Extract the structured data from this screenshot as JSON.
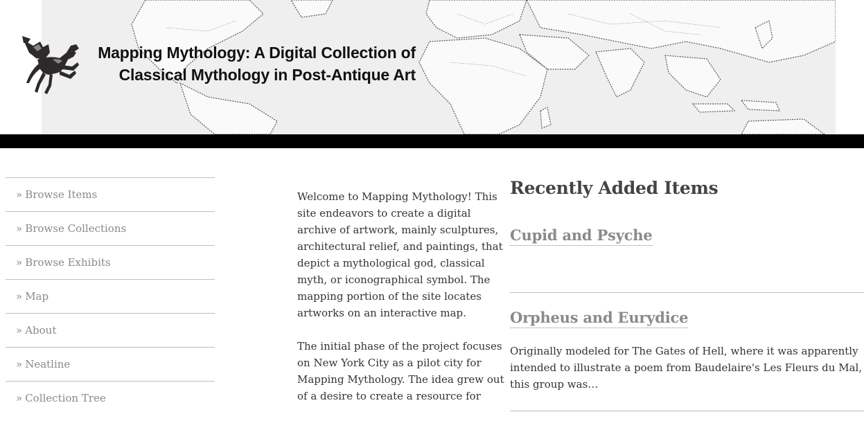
{
  "header": {
    "title_line1": "Mapping Mythology: A Digital Collection of",
    "title_line2": "Classical Mythology in Post-Antique Art",
    "logo_icon": "pegasus-statue-icon",
    "background_icon": "world-map-background"
  },
  "nav": {
    "items": [
      {
        "label": "Browse Items"
      },
      {
        "label": "Browse Collections"
      },
      {
        "label": "Browse Exhibits"
      },
      {
        "label": "Map"
      },
      {
        "label": "About"
      },
      {
        "label": "Neatline"
      },
      {
        "label": "Collection Tree"
      }
    ],
    "prefix": "»"
  },
  "intro": {
    "paragraph1": "Welcome to Mapping Mythology!  This site endeavors to create a digital archive of artwork, mainly sculptures, architectural relief, and paintings, that depict a mythological god, classical myth, or iconographical symbol.  The mapping portion of the site locates artworks on an interactive map.",
    "paragraph2": "The initial phase of the project focuses on New York City as a pilot city for Mapping Mythology.  The idea grew out of a desire to create a resource for"
  },
  "recent": {
    "heading": "Recently Added Items",
    "items": [
      {
        "title": "Cupid and Psyche",
        "description": ""
      },
      {
        "title": "Orpheus and Eurydice",
        "description": "Originally modeled for The Gates of Hell, where it was apparently intended to illustrate a poem from Baudelaire's Les Fleurs du Mal, this group was…"
      }
    ]
  },
  "colors": {
    "header_bar": "#000000",
    "nav_text": "#8a8a8a",
    "body_text": "#333333",
    "divider": "#bdbdbd"
  }
}
